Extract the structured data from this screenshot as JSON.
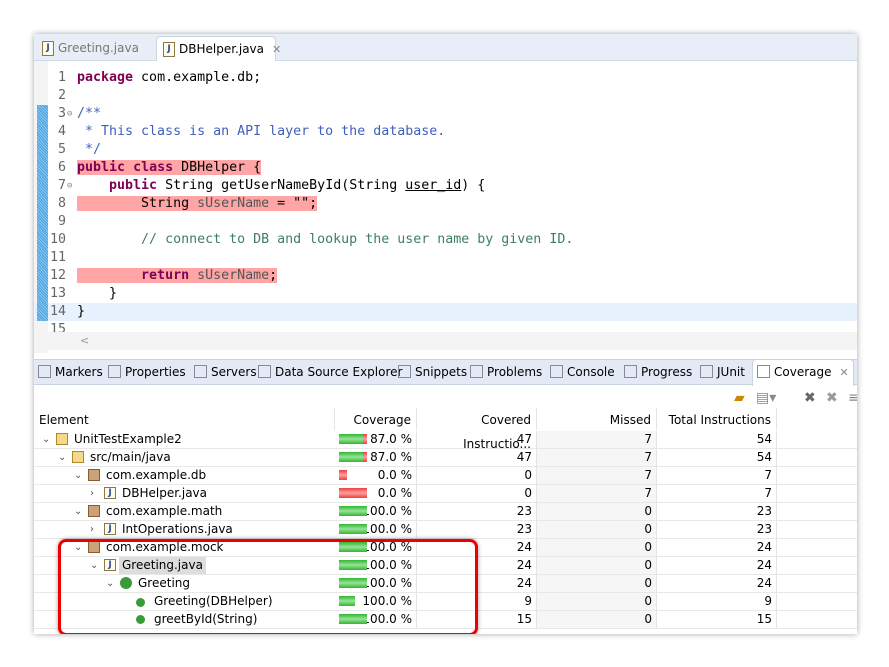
{
  "editor": {
    "tabs": [
      {
        "label": "Greeting.java",
        "active": false
      },
      {
        "label": "DBHelper.java",
        "active": true
      }
    ],
    "lines": [
      {
        "n": "1",
        "html": "<span class='kw'>package</span> com.example.db;",
        "hl": false,
        "cov": false,
        "fold": false
      },
      {
        "n": "2",
        "html": "",
        "hl": false,
        "cov": false,
        "fold": false
      },
      {
        "n": "3",
        "html": "<span class='cm'>/**</span>",
        "hl": false,
        "cov": true,
        "fold": true
      },
      {
        "n": "4",
        "html": "<span class='cm'> * This class is an API layer to the database.</span>",
        "hl": false,
        "cov": true,
        "fold": false
      },
      {
        "n": "5",
        "html": "<span class='cm'> */</span>",
        "hl": false,
        "cov": true,
        "fold": false
      },
      {
        "n": "6",
        "html": "<span class='hl'><span class='kw'>public</span> <span class='kw'>class</span> DBHelper {</span>",
        "hl": false,
        "cov": true,
        "fold": false
      },
      {
        "n": "7",
        "html": "    <span class='kw'>public</span> String getUserNameById(String <u>user_id</u>) {",
        "hl": false,
        "cov": true,
        "fold": true
      },
      {
        "n": "8",
        "html": "<span class='hl'>        String <span class='fld'>sUserName</span> = \"\";</span>",
        "hl": false,
        "cov": true,
        "fold": false
      },
      {
        "n": "9",
        "html": "",
        "hl": false,
        "cov": true,
        "fold": false
      },
      {
        "n": "10",
        "html": "        <span class='cm2'>// connect to DB and lookup the user name by given ID.</span>",
        "hl": false,
        "cov": true,
        "fold": false
      },
      {
        "n": "11",
        "html": "",
        "hl": false,
        "cov": true,
        "fold": false
      },
      {
        "n": "12",
        "html": "<span class='hl'>        <span class='kw'>return</span> <span class='fld'>sUserName</span>;</span>",
        "hl": false,
        "cov": true,
        "fold": false
      },
      {
        "n": "13",
        "html": "    }",
        "hl": false,
        "cov": true,
        "fold": false
      },
      {
        "n": "14",
        "html": "}",
        "hl": false,
        "cov": true,
        "fold": false,
        "current": true
      },
      {
        "n": "15",
        "html": "",
        "hl": false,
        "cov": false,
        "fold": false
      }
    ]
  },
  "panel": {
    "tabs": [
      {
        "label": "Markers",
        "icon": "markers-icon"
      },
      {
        "label": "Properties",
        "icon": "properties-icon"
      },
      {
        "label": "Servers",
        "icon": "servers-icon"
      },
      {
        "label": "Data Source Explorer",
        "icon": "data-source-icon"
      },
      {
        "label": "Snippets",
        "icon": "snippets-icon"
      },
      {
        "label": "Problems",
        "icon": "problems-icon"
      },
      {
        "label": "Console",
        "icon": "console-icon"
      },
      {
        "label": "Progress",
        "icon": "progress-icon"
      },
      {
        "label": "JUnit",
        "icon": "junit-icon"
      },
      {
        "label": "Coverage",
        "icon": "coverage-icon",
        "active": true
      }
    ]
  },
  "coverage": {
    "columns": [
      "Element",
      "Coverage",
      "Covered Instructio...",
      "Missed Instructions",
      "Total Instructions"
    ],
    "rows": [
      {
        "name": "UnitTestExample2",
        "depth": 0,
        "icon": "project",
        "exp": "open",
        "cov": "87.0 %",
        "pct": 87,
        "covered": "47",
        "missed": "7",
        "total": "54"
      },
      {
        "name": "src/main/java",
        "depth": 1,
        "icon": "srcfolder",
        "exp": "open",
        "cov": "87.0 %",
        "pct": 87,
        "covered": "47",
        "missed": "7",
        "total": "54"
      },
      {
        "name": "com.example.db",
        "depth": 2,
        "icon": "package",
        "exp": "open",
        "cov": "0.0 %",
        "pct": 0,
        "covered": "0",
        "missed": "7",
        "total": "7"
      },
      {
        "name": "DBHelper.java",
        "depth": 3,
        "icon": "java",
        "exp": "closed",
        "cov": "0.0 %",
        "pct": 0,
        "covered": "0",
        "missed": "7",
        "total": "7"
      },
      {
        "name": "com.example.math",
        "depth": 2,
        "icon": "package",
        "exp": "open",
        "cov": "100.0 %",
        "pct": 100,
        "covered": "23",
        "missed": "0",
        "total": "23"
      },
      {
        "name": "IntOperations.java",
        "depth": 3,
        "icon": "java",
        "exp": "closed",
        "cov": "100.0 %",
        "pct": 100,
        "covered": "23",
        "missed": "0",
        "total": "23"
      },
      {
        "name": "com.example.mock",
        "depth": 2,
        "icon": "package",
        "exp": "open",
        "cov": "100.0 %",
        "pct": 100,
        "covered": "24",
        "missed": "0",
        "total": "24"
      },
      {
        "name": "Greeting.java",
        "depth": 3,
        "icon": "java",
        "exp": "open",
        "cov": "100.0 %",
        "pct": 100,
        "covered": "24",
        "missed": "0",
        "total": "24",
        "selected": true
      },
      {
        "name": "Greeting",
        "depth": 4,
        "icon": "class",
        "exp": "open",
        "cov": "100.0 %",
        "pct": 100,
        "covered": "24",
        "missed": "0",
        "total": "24"
      },
      {
        "name": "Greeting(DBHelper)",
        "depth": 5,
        "icon": "constructor",
        "exp": "none",
        "cov": "100.0 %",
        "pct": 100,
        "covered": "9",
        "missed": "0",
        "total": "9"
      },
      {
        "name": "greetById(String)",
        "depth": 5,
        "icon": "method",
        "exp": "none",
        "cov": "100.0 %",
        "pct": 100,
        "covered": "15",
        "missed": "0",
        "total": "15"
      }
    ]
  },
  "colors": {
    "covered": "#2eb82e",
    "missed": "#f03c3c",
    "highlight": "#ffa5a5",
    "annotation": "#e00000"
  }
}
